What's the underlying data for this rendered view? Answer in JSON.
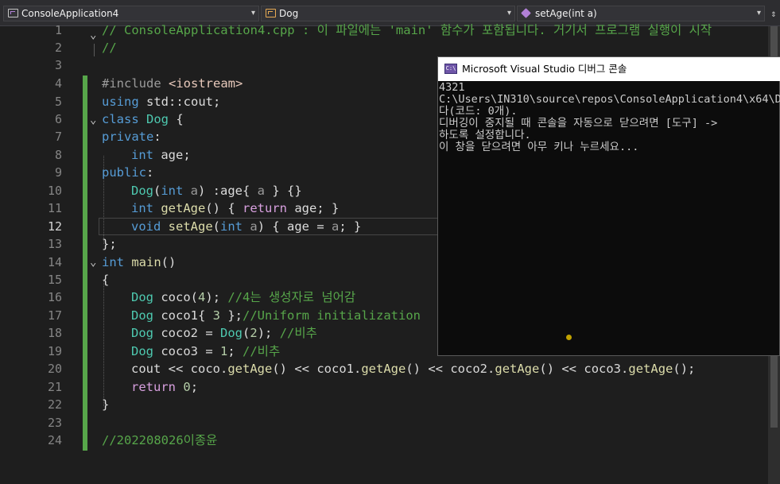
{
  "nav": {
    "project": "ConsoleApplication4",
    "scope": "Dog",
    "member": "setAge(int a)",
    "project_icon": "project-icon",
    "scope_icon": "class-icon",
    "member_icon": "method-icon",
    "split_icon": "split-icon"
  },
  "editor": {
    "active_line": "12",
    "lines": [
      {
        "n": "1"
      },
      {
        "n": "2"
      },
      {
        "n": "3"
      },
      {
        "n": "4"
      },
      {
        "n": "5"
      },
      {
        "n": "6"
      },
      {
        "n": "7"
      },
      {
        "n": "8"
      },
      {
        "n": "9"
      },
      {
        "n": "10"
      },
      {
        "n": "11"
      },
      {
        "n": "12"
      },
      {
        "n": "13"
      },
      {
        "n": "14"
      },
      {
        "n": "15"
      },
      {
        "n": "16"
      },
      {
        "n": "17"
      },
      {
        "n": "18"
      },
      {
        "n": "19"
      },
      {
        "n": "20"
      },
      {
        "n": "21"
      },
      {
        "n": "22"
      },
      {
        "n": "23"
      },
      {
        "n": "24"
      }
    ],
    "t": {
      "l1_comment": "// ConsoleApplication4.cpp : 이 파일에는 'main' 함수가 포함됩니다. 거기서 프로그램 실행이 시작",
      "l2_comment": "//",
      "l4_inc": "#include",
      "l4_hdr": "<iostream>",
      "l5_using": "using",
      "l5_rest": " std::cout;",
      "l6_class": "class",
      "l6_name": "Dog",
      "l6_brace": " {",
      "l7_private": "private",
      "l7_colon": ":",
      "l8_int": "int",
      "l8_age": " age;",
      "l9_public": "public",
      "l9_colon": ":",
      "l10_dog": "Dog",
      "l10_p1": "(",
      "l10_int": "int",
      "l10_a": " a",
      "l10_rest": ") :age{ ",
      "l10_a2": "a",
      "l10_end": " } {}",
      "l11_int": "int",
      "l11_fn": "getAge",
      "l11_p": "() { ",
      "l11_ret": "return",
      "l11_rest": " age; }",
      "l12_void": "void",
      "l12_fn": "setAge",
      "l12_p": "(",
      "l12_int": "int",
      "l12_a": " a",
      "l12_rest": ") { age = ",
      "l12_a2": "a",
      "l12_end": "; }",
      "l13_end": "};",
      "l14_int": "int",
      "l14_main": "main",
      "l14_p": "()",
      "l15_brace": "{",
      "l16_dog": "Dog",
      "l16_var": " coco",
      "l16_p": "(",
      "l16_num": "4",
      "l16_e": "); ",
      "l16_cm": "//4는 생성자로 넘어감",
      "l17_dog": "Dog",
      "l17_var": " coco1",
      "l17_b": "{ ",
      "l17_num": "3",
      "l17_e": " };",
      "l17_cm": "//Uniform initialization",
      "l18_dog": "Dog",
      "l18_var": " coco2",
      "l18_eq": " = ",
      "l18_dog2": "Dog",
      "l18_p": "(",
      "l18_num": "2",
      "l18_e": "); ",
      "l18_cm": "//비추",
      "l19_dog": "Dog",
      "l19_var": " coco3",
      "l19_eq": " = ",
      "l19_num": "1",
      "l19_e": "; ",
      "l19_cm": "//비추",
      "l20_cout": "cout",
      "l20_o1": " << ",
      "l20_c0": "coco",
      "l20_d1": ".",
      "l20_g1": "getAge",
      "l20_p1": "() << ",
      "l20_c1": "coco1",
      "l20_d2": ".",
      "l20_g2": "getAge",
      "l20_p2": "() << ",
      "l20_c2": "coco2",
      "l20_d3": ".",
      "l20_g3": "getAge",
      "l20_p3": "() << ",
      "l20_c3": "coco3",
      "l20_d4": ".",
      "l20_g4": "getAge",
      "l20_p4": "();",
      "l21_ret": "return",
      "l21_sp": " ",
      "l21_num": "0",
      "l21_e": ";",
      "l22_brace": "}",
      "l24_cm": "//202208026이종윤"
    }
  },
  "console": {
    "title": "Microsoft Visual Studio 디버그 콘솔",
    "icon_label": "C:\\",
    "lines": [
      "4321",
      "C:\\Users\\IN310\\source\\repos\\ConsoleApplication4\\x64\\De",
      "다(코드: 0개).",
      "디버깅이 중지될 때 콘솔을 자동으로 닫으려면 [도구] ->",
      "하도록 설정합니다.",
      "이 창을 닫으려면 아무 키나 누르세요..."
    ]
  },
  "colors": {
    "editor_bg": "#1e1e1e",
    "keyword": "#569cd6",
    "type": "#4ec9b0",
    "comment": "#57a64a",
    "function": "#dcdcaa",
    "number": "#b5cea8",
    "control": "#d8a0df",
    "console_bg": "#0c0c0c"
  }
}
